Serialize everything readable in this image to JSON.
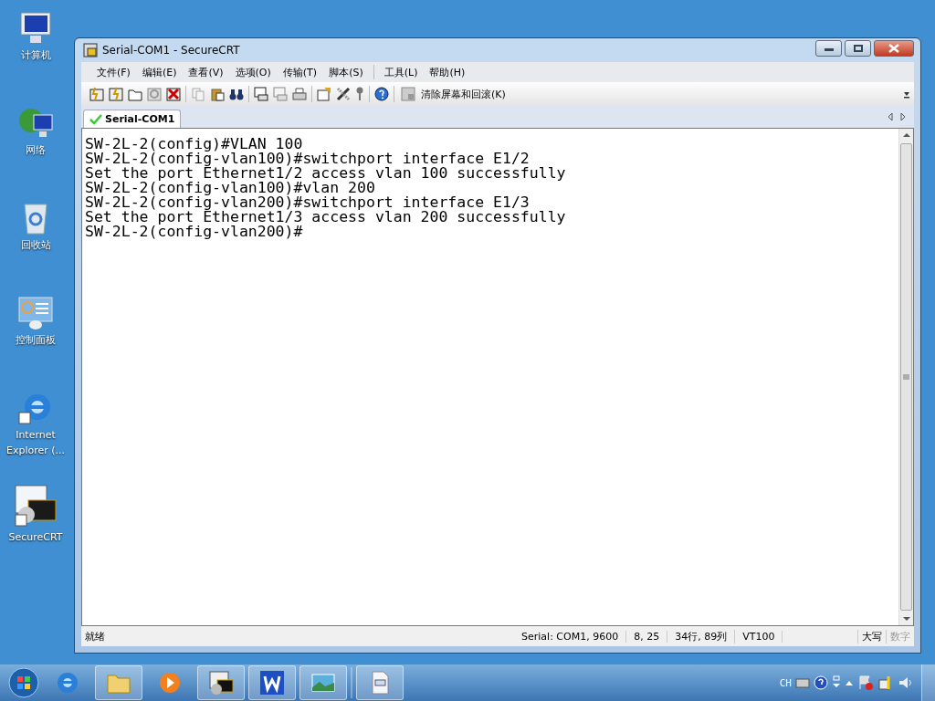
{
  "desktop_icons": [
    {
      "label": "计算机",
      "kind": "computer"
    },
    {
      "label": "网络",
      "kind": "network"
    },
    {
      "label": "回收站",
      "kind": "recycle"
    },
    {
      "label": "控制面板",
      "kind": "control"
    },
    {
      "label": "Internet Explorer (...",
      "kind": "ie"
    },
    {
      "label": "SecureCRT",
      "kind": "crt"
    }
  ],
  "window": {
    "title": "Serial-COM1 - SecureCRT"
  },
  "menu": [
    "文件(F)",
    "编辑(E)",
    "查看(V)",
    "选项(O)",
    "传输(T)",
    "脚本(S)",
    "工具(L)",
    "帮助(H)"
  ],
  "toolbar": {
    "clear_button": "清除屏幕和回滚(K)"
  },
  "tabs": [
    {
      "label": "Serial-COM1",
      "selected": true
    }
  ],
  "terminal": {
    "lines": [
      "SW-2L-2(config)#VLAN 100",
      "SW-2L-2(config-vlan100)#switchport interface E1/2",
      "Set the port Ethernet1/2 access vlan 100 successfully",
      "SW-2L-2(config-vlan100)#vlan 200",
      "SW-2L-2(config-vlan200)#switchport interface E1/3",
      "Set the port Ethernet1/3 access vlan 200 successfully",
      "SW-2L-2(config-vlan200)#"
    ]
  },
  "status_bar": {
    "message": "就绪",
    "fields": [
      "Serial: COM1, 9600",
      "8,  25",
      "34行, 89列",
      "VT100"
    ],
    "indicators": [
      {
        "label": "大写",
        "on": true
      },
      {
        "label": "数字",
        "on": false
      }
    ]
  },
  "taskbar": {
    "language": "CH"
  }
}
